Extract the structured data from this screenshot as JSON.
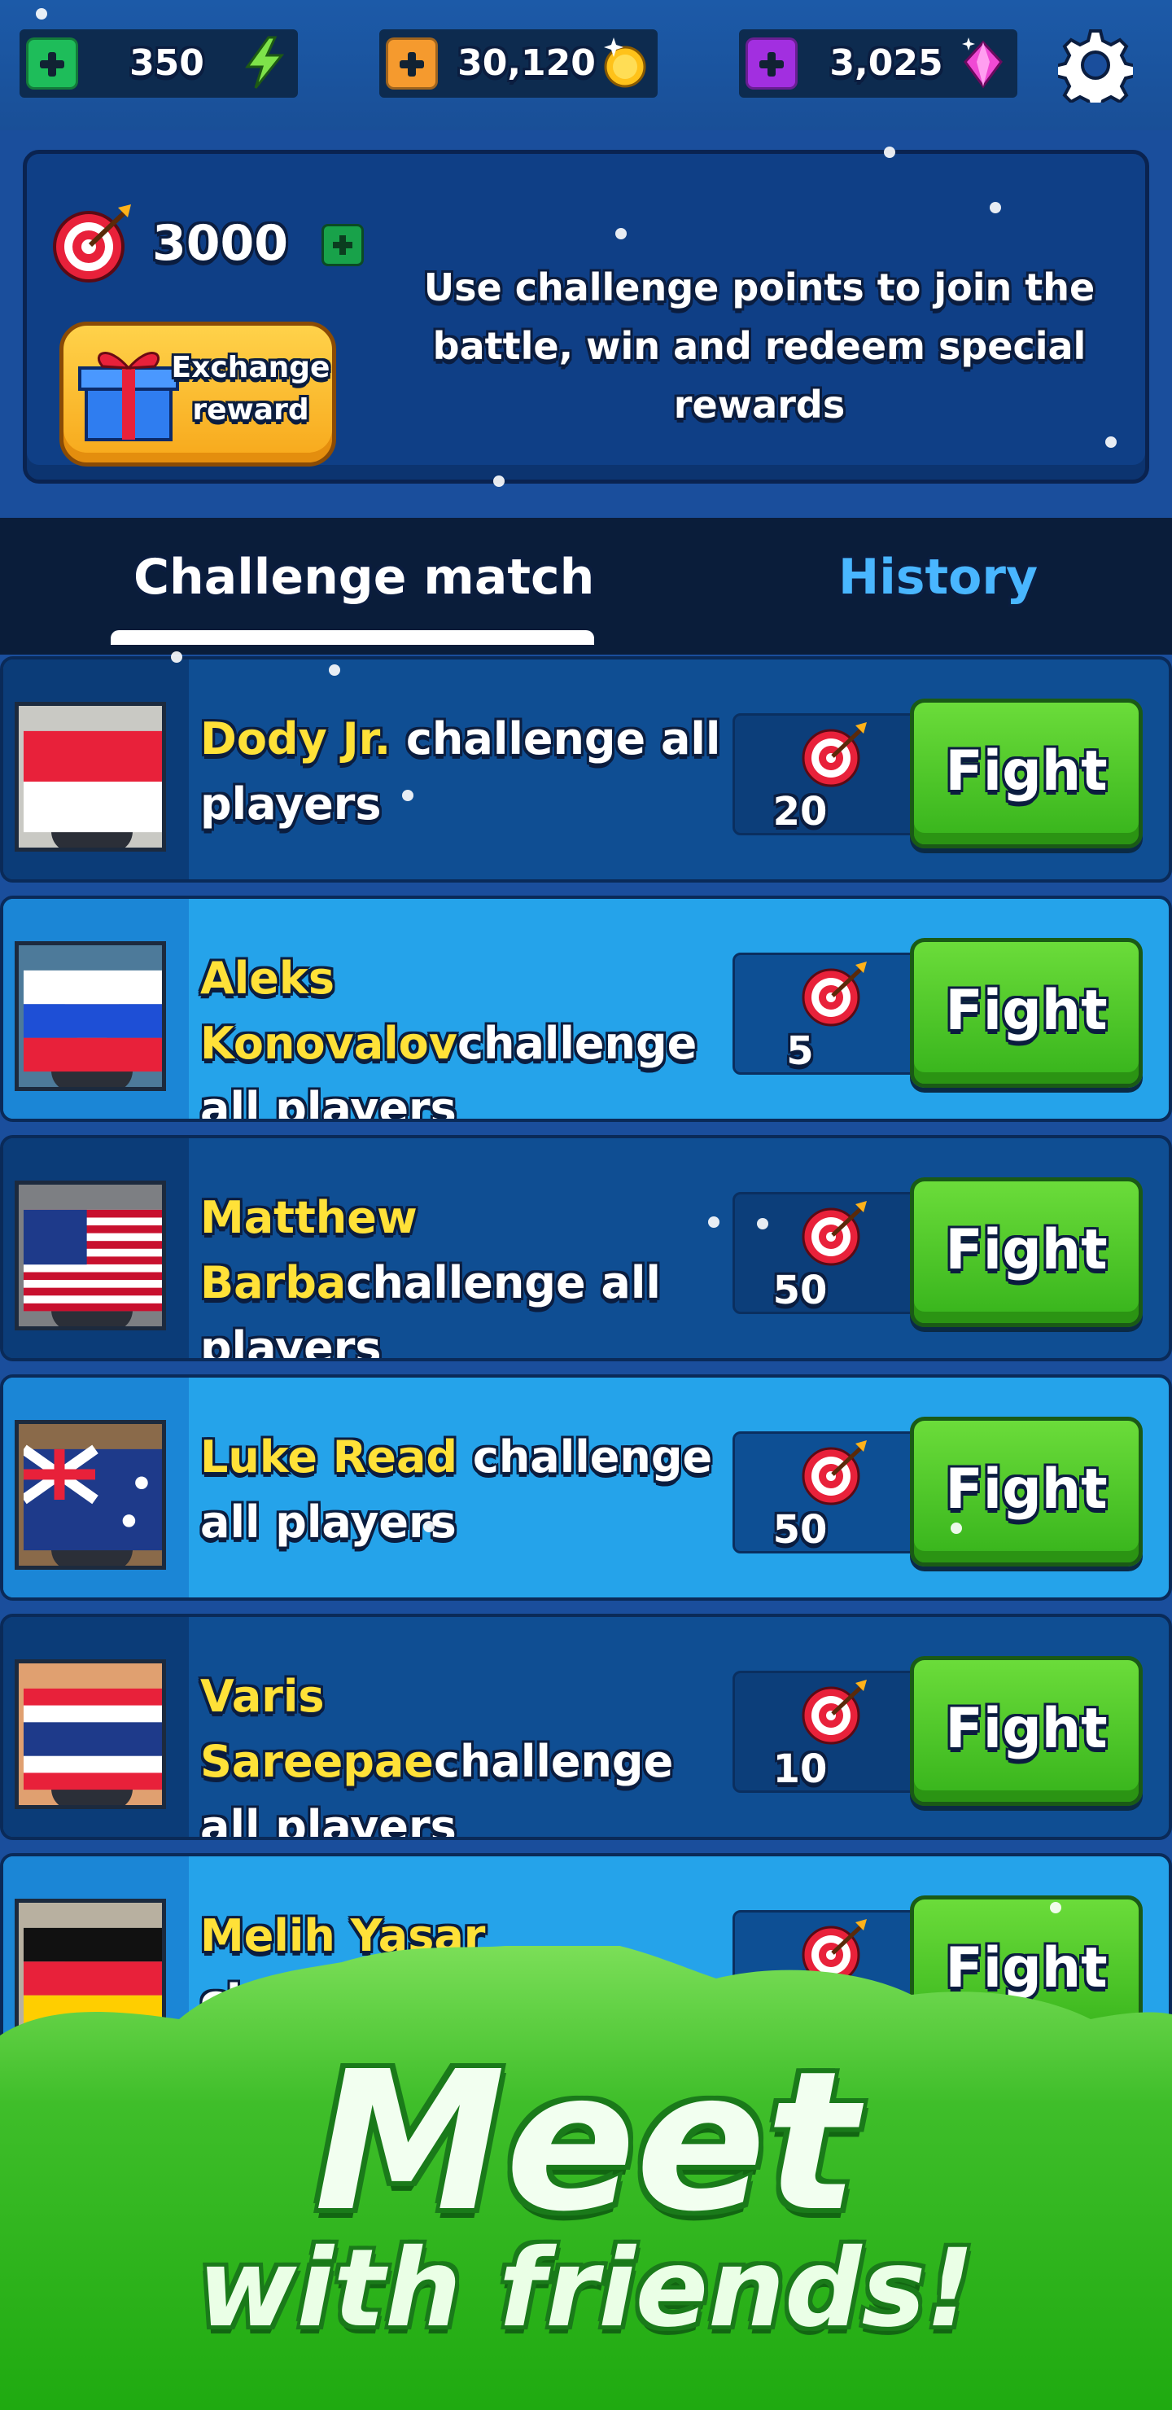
{
  "resources": [
    {
      "value": "350",
      "plus_color": "#1ebd5a",
      "icon": "lightning-icon"
    },
    {
      "value": "30,120",
      "plus_color": "#f59a2e",
      "icon": "gold-coin-icon"
    },
    {
      "value": "3,025",
      "plus_color": "#a22fe0",
      "icon": "pink-gem-icon"
    }
  ],
  "challenge_panel": {
    "points": "3000",
    "exchange_label": "Exchange\nreward",
    "description": "Use challenge points to join the battle, win and redeem special rewards"
  },
  "tabs": [
    {
      "label": "Challenge match",
      "active": true
    },
    {
      "label": "History",
      "active": false
    }
  ],
  "challenges": [
    {
      "player": "Dody Jr.",
      "text": " challenge all players",
      "cost": "20",
      "flag": "indonesia",
      "fight": "Fight"
    },
    {
      "player": "Aleks Konovalov",
      "text": "challenge all players",
      "cost": "5",
      "flag": "russia",
      "fight": "Fight"
    },
    {
      "player": "Matthew Barba",
      "text": "challenge all players",
      "cost": "50",
      "flag": "usa",
      "fight": "Fight"
    },
    {
      "player": "Luke Read",
      "text": " challenge all players",
      "cost": "50",
      "flag": "australia",
      "fight": "Fight"
    },
    {
      "player": "Varis Sareepae",
      "text": "challenge all players",
      "cost": "10",
      "flag": "thailand",
      "fight": "Fight"
    },
    {
      "player": "Melih Yasar",
      "text": " challenge all players",
      "cost": "",
      "flag": "germany",
      "fight": "Fight"
    }
  ],
  "promo": {
    "title": "Meet",
    "subtitle": "with friends!"
  },
  "colors": {
    "accent_name": "#ffe138",
    "fight_green": "#4ac426",
    "history_tab": "#49b6ff"
  }
}
